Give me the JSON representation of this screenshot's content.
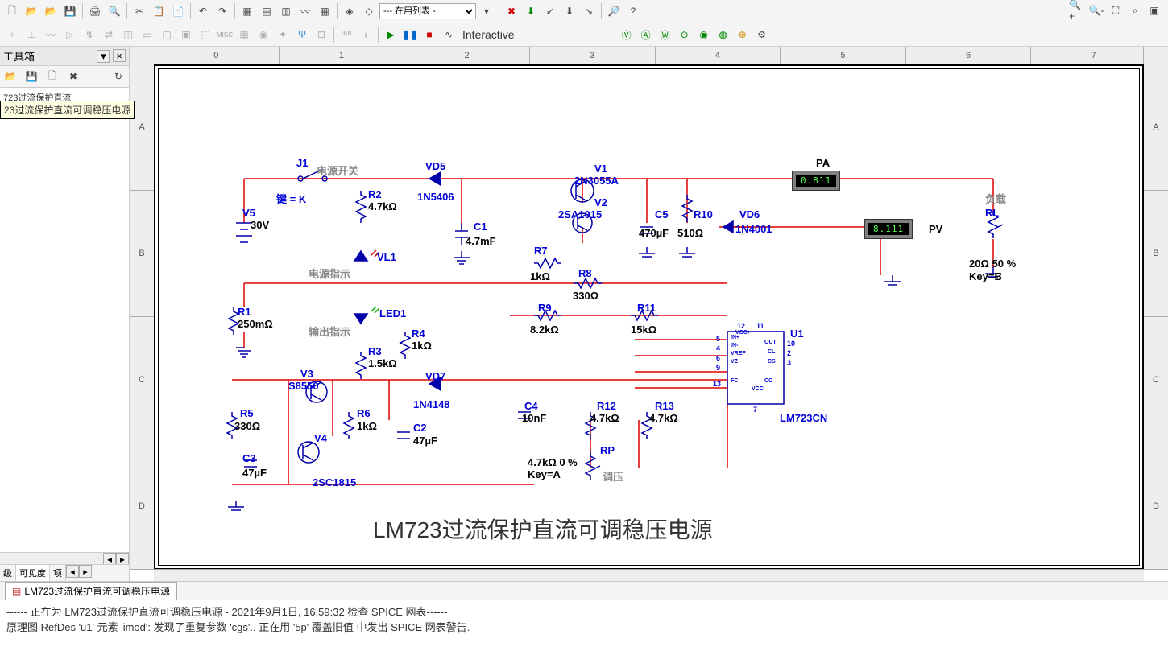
{
  "toolbar": {
    "combo_value": "--- 在用列表 -",
    "mode_label": "Interactive"
  },
  "side": {
    "title": "工具箱",
    "item_trunc": "723过流保护直流",
    "tooltip": "23过流保护直流可调稳压电源",
    "tabs": [
      "级",
      "可见度",
      "项"
    ]
  },
  "ruler_h": [
    "0",
    "1",
    "2",
    "3",
    "4",
    "5",
    "6",
    "7"
  ],
  "ruler_v": [
    "A",
    "B",
    "C",
    "D"
  ],
  "schematic_title": "LM723过流保护直流可调稳压电源",
  "doc_tab": "LM723过流保护直流可调稳压电源",
  "log": [
    "------ 正在为 LM723过流保护直流可调稳压电源 - 2021年9月1日, 16:59:32 检查 SPICE 网表------",
    "原理图 RefDes 'u1' 元素 'imod': 发现了重复参数 'cgs'.. 正在用 '5p' 覆盖旧值 中发出 SPICE 网表警告."
  ],
  "meters": {
    "pa_label": "PA",
    "pa_value": "0.811",
    "pv_label": "PV",
    "pv_value": "8.111"
  },
  "comp": {
    "J1": "J1",
    "J1_note": "电源开关",
    "J1_key": "键 = K",
    "V5": "V5",
    "V5_val": "30V",
    "R1": "R1",
    "R1_val": "250mΩ",
    "R2": "R2",
    "R2_val": "4.7kΩ",
    "VL1": "VL1",
    "VL1_note": "电源指示",
    "LED1": "LED1",
    "LED1_note": "输出指示",
    "R3": "R3",
    "R3_val": "1.5kΩ",
    "R4": "R4",
    "R4_val": "1kΩ",
    "VD5": "VD5",
    "VD5_val": "1N5406",
    "VD7": "VD7",
    "VD7_val": "1N4148",
    "V1": "V1",
    "V1_val": "2N3055A",
    "V2": "V2",
    "V2_val": "2SA1015",
    "V3": "V3",
    "V3_val": "S8550",
    "V4": "V4",
    "V4_val": "2SC1815",
    "C1": "C1",
    "C1_val": "4.7mF",
    "C2": "C2",
    "C2_val": "47µF",
    "C3": "C3",
    "C3_val": "47µF",
    "C4": "C4",
    "C4_val": "10nF",
    "C5": "C5",
    "C5_val": "470µF",
    "R5": "R5",
    "R5_val": "330Ω",
    "R6": "R6",
    "R6_val": "1kΩ",
    "R7": "R7",
    "R7_val": "1kΩ",
    "R8": "R8",
    "R8_val": "330Ω",
    "R9": "R9",
    "R9_val": "8.2kΩ",
    "R10": "R10",
    "R10_val": "510Ω",
    "R11": "R11",
    "R11_val": "15kΩ",
    "R12": "R12",
    "R12_val": "4.7kΩ",
    "R13": "R13",
    "R13_val": "4.7kΩ",
    "VD6": "VD6",
    "VD6_val": "1N4001",
    "U1": "U1",
    "U1_val": "LM723CN",
    "RP": "RP",
    "RP_val": "4.7kΩ  0 %",
    "RP_key": "Key=A",
    "RP_note": "调压",
    "RL": "RL",
    "RL_val": "20Ω 50 %",
    "RL_key": "Key=B",
    "RL_note": "负载",
    "U1_pins": {
      "p5": "5",
      "p4": "4",
      "p6": "6",
      "p13": "13",
      "p12": "12",
      "p11": "11",
      "p10": "10",
      "p2": "2",
      "p3": "3",
      "p9": "9",
      "p7": "7",
      "pin_in_p": "IN+",
      "pin_in_m": "IN-",
      "pin_vref": "VREF",
      "pin_vz": "VZ",
      "pin_fc": "FC",
      "pin_vccp": "VCC+",
      "pin_out": "OUT",
      "pin_cl": "CL",
      "pin_cs": "CS",
      "pin_co": "CO",
      "pin_vccm": "VCC-"
    }
  }
}
